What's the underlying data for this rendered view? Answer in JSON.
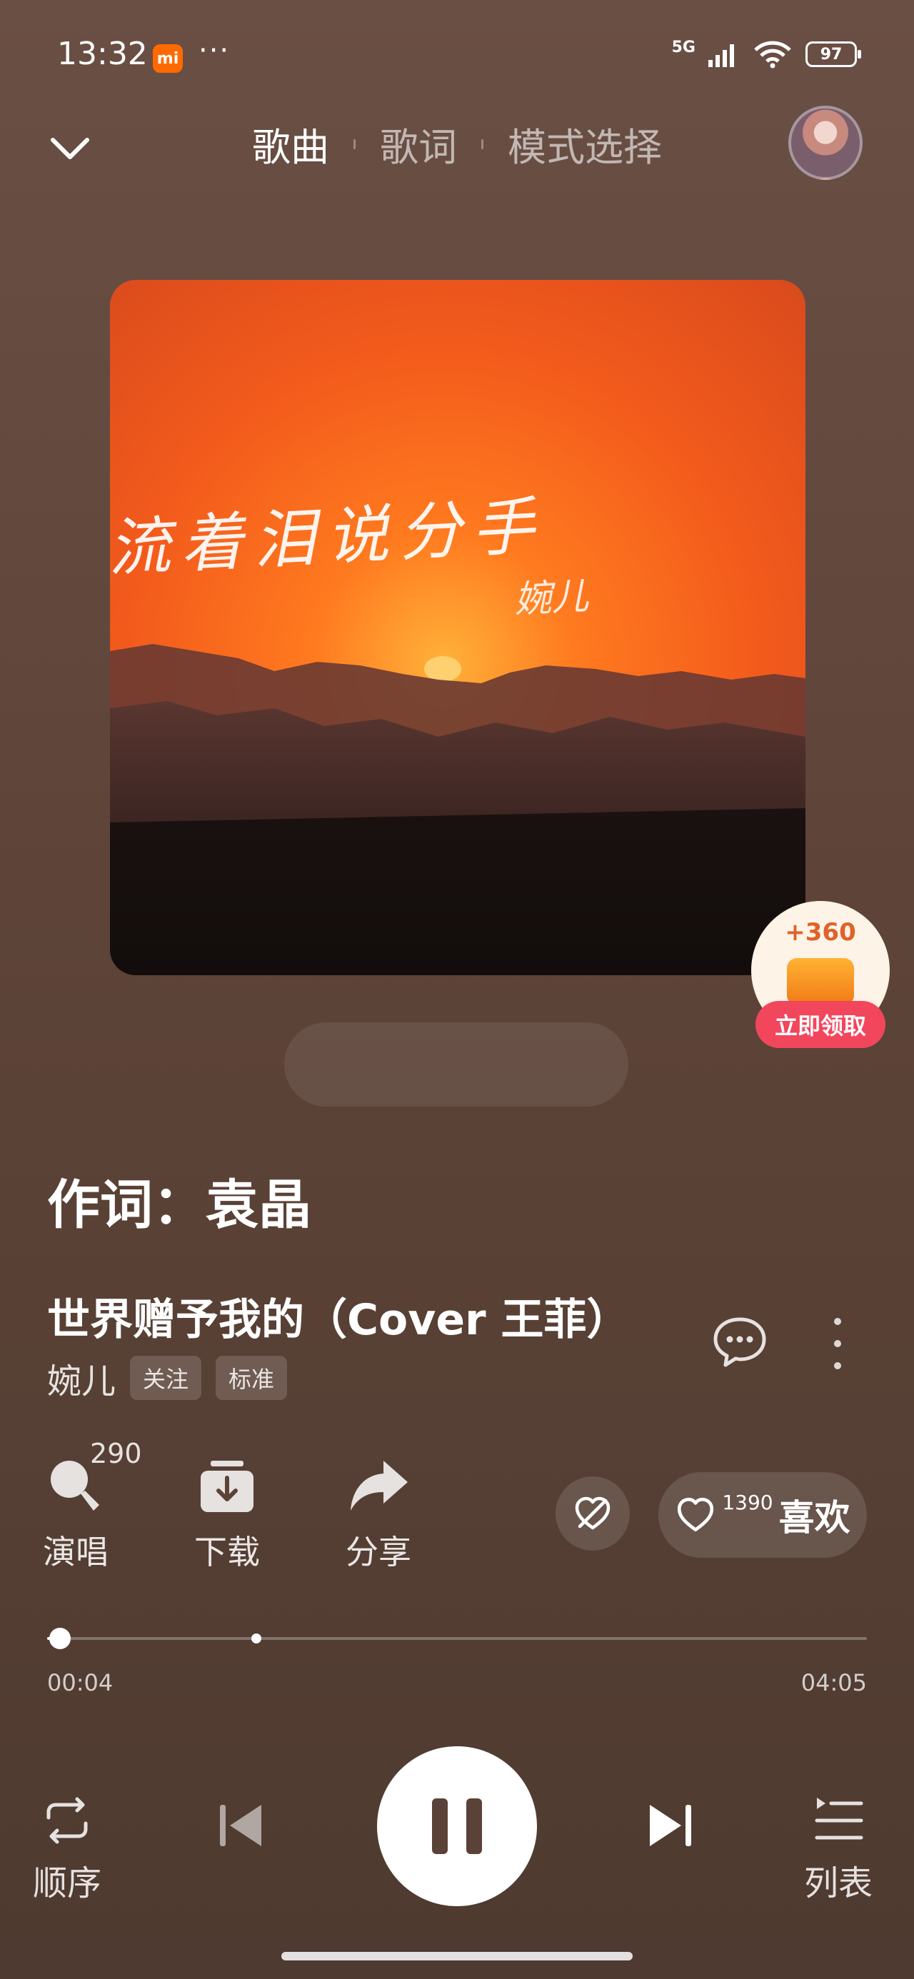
{
  "status_bar": {
    "time": "13:32",
    "app_badge": "mi",
    "more": "···",
    "network": "5G",
    "battery": "97"
  },
  "header": {
    "tabs": [
      "歌曲",
      "歌词",
      "模式选择"
    ],
    "active_tab": 0
  },
  "cover": {
    "title": "流着泪说分手",
    "artist": "婉儿"
  },
  "promo": {
    "points": "+360",
    "cta": "立即领取"
  },
  "lyric": {
    "current_line": "作词：袁晶"
  },
  "song": {
    "title": "世界赠予我的（Cover 王菲）",
    "artist": "婉儿",
    "follow_tag": "关注",
    "quality_tag": "标准"
  },
  "actions": {
    "sing_label": "演唱",
    "sing_count": "290",
    "download_label": "下载",
    "share_label": "分享",
    "like_label": "喜欢",
    "like_count": "1390"
  },
  "progress": {
    "current": "00:04",
    "total": "04:05",
    "fraction": 0.016
  },
  "controls": {
    "mode_label": "顺序",
    "list_label": "列表"
  },
  "colors": {
    "background": "#5e4438",
    "accent": "#ff6a00",
    "promo_button": "#f2465d"
  }
}
